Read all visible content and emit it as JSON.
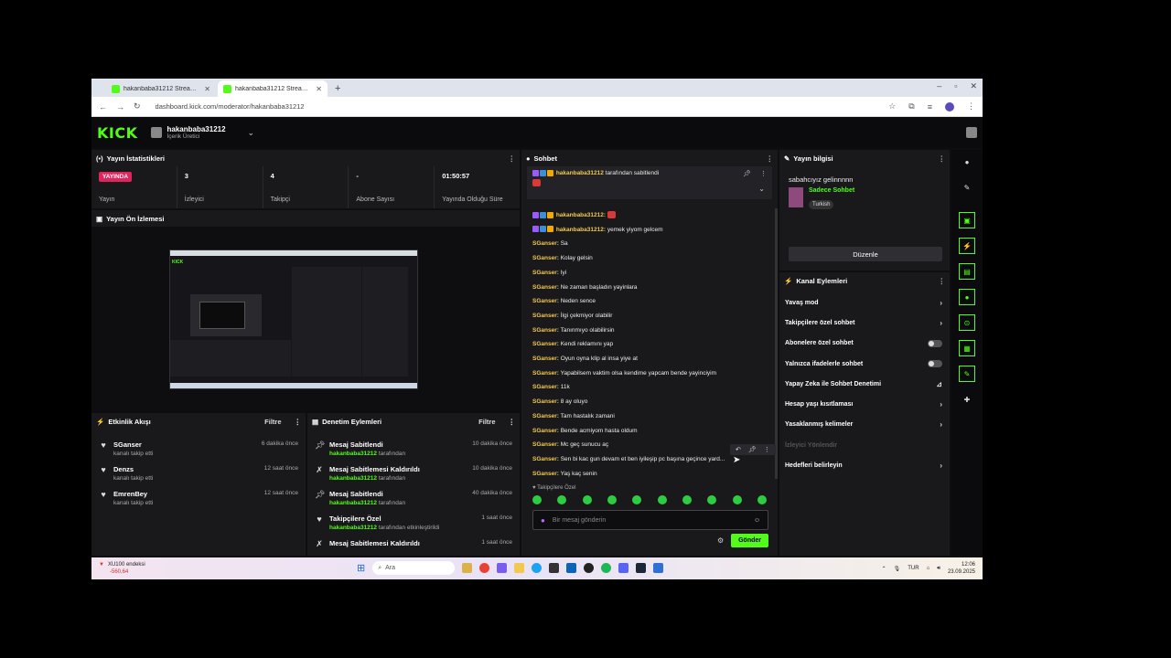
{
  "browser": {
    "tabs": [
      {
        "title": "hakanbaba31212 Stream - Wa...",
        "active": false
      },
      {
        "title": "hakanbaba31212 Stream - Kick",
        "active": true
      }
    ],
    "new_tab": "+",
    "url": "dashboard.kick.com/moderator/hakanbaba31212",
    "window_controls": [
      "–",
      "▫",
      "✕"
    ]
  },
  "header": {
    "logo": "KICK",
    "channel_name": "hakanbaba31212",
    "channel_role": "İçerik Üretici"
  },
  "stats": {
    "title": "Yayın İstatistikleri",
    "items": [
      {
        "value": "YAYINDA",
        "label": "Yayın",
        "badge": true
      },
      {
        "value": "3",
        "label": "İzleyici"
      },
      {
        "value": "4",
        "label": "Takipçi"
      },
      {
        "value": "-",
        "label": "Abone Sayısı"
      },
      {
        "value": "01:50:57",
        "label": "Yayında Olduğu Süre"
      }
    ]
  },
  "preview": {
    "title": "Yayın Ön İzlemesi"
  },
  "activity": {
    "title": "Etkinlik Akışı",
    "filter": "Filtre",
    "items": [
      {
        "name": "SGanser",
        "sub": "kanalı takip etti",
        "time": "6 dakika önce"
      },
      {
        "name": "Denzs",
        "sub": "kanalı takip etti",
        "time": "12 saat önce"
      },
      {
        "name": "EmrenBey",
        "sub": "kanalı takip etti",
        "time": "12 saat önce"
      }
    ]
  },
  "mod_actions": {
    "title": "Denetim Eylemleri",
    "filter": "Filtre",
    "items": [
      {
        "name": "Mesaj Sabitlendi",
        "user": "hakanbaba31212",
        "rest": "tarafından",
        "time": "10 dakika önce",
        "icon": "pin"
      },
      {
        "name": "Mesaj Sabitlemesi Kaldırıldı",
        "user": "hakanbaba31212",
        "rest": "tarafından",
        "time": "10 dakika önce",
        "icon": "unpin"
      },
      {
        "name": "Mesaj Sabitlendi",
        "user": "hakanbaba31212",
        "rest": "tarafından",
        "time": "40 dakika önce",
        "icon": "pin"
      },
      {
        "name": "Takipçilere Özel",
        "user": "hakanbaba31212",
        "rest": "tarafından etkinleştirildi",
        "time": "1 saat önce",
        "icon": "heart"
      },
      {
        "name": "Mesaj Sabitlemesi Kaldırıldı",
        "user": "",
        "rest": "",
        "time": "1 saat önce",
        "icon": "unpin"
      }
    ]
  },
  "chat": {
    "title": "Sohbet",
    "pinned": {
      "user": "hakanbaba31212",
      "text": "tarafından sabitlendi"
    },
    "messages": [
      {
        "user": "hakanbaba31212:",
        "text": "",
        "badges": true,
        "emote": true
      },
      {
        "user": "hakanbaba31212:",
        "text": "yemek yiyom gelcem",
        "badges": true
      },
      {
        "user": "SGanser:",
        "text": "Sa"
      },
      {
        "user": "SGanser:",
        "text": "Kolay gelsin"
      },
      {
        "user": "SGanser:",
        "text": "Iyi"
      },
      {
        "user": "SGanser:",
        "text": "Ne zaman başladın yayinlara"
      },
      {
        "user": "SGanser:",
        "text": "Neden sence"
      },
      {
        "user": "SGanser:",
        "text": "İlgi çekmiyor olabilir"
      },
      {
        "user": "SGanser:",
        "text": "Tanınmıyo olabilirsin"
      },
      {
        "user": "SGanser:",
        "text": "Kendi reklamını yap"
      },
      {
        "user": "SGanser:",
        "text": "Oyun oyna klip al insa yiye at"
      },
      {
        "user": "SGanser:",
        "text": "Yapabilsem vaktim olsa kendime yapcam bende yayinciyim"
      },
      {
        "user": "SGanser:",
        "text": "11k"
      },
      {
        "user": "SGanser:",
        "text": "8 ay oluyo"
      },
      {
        "user": "SGanser:",
        "text": "Tam hastalık zamani"
      },
      {
        "user": "SGanser:",
        "text": "Bende acmiyom hasta oldum"
      },
      {
        "user": "SGanser:",
        "text": "Mc geç sunucu aç"
      },
      {
        "user": "SGanser:",
        "text": "Sen bi kac gun devam et ben iyileşip pc başına geçince yard..."
      },
      {
        "user": "SGanser:",
        "text": "Yaş kaç senin"
      }
    ],
    "follower_only": "♥ Takipçilere Özel",
    "input_placeholder": "Bir mesaj gönderin",
    "send": "Gönder"
  },
  "stream_info": {
    "title": "Yayın bilgisi",
    "stream_title": "sabahcıyız gelinnnnn",
    "category": "Sadece Sohbet",
    "tag": "Turkish",
    "edit": "Düzenle"
  },
  "channel_actions": {
    "title": "Kanal Eylemleri",
    "items": [
      {
        "label": "Yavaş mod",
        "control": "chevron"
      },
      {
        "label": "Takipçilere özel sohbet",
        "control": "chevron"
      },
      {
        "label": "Abonelere özel sohbet",
        "control": "toggle"
      },
      {
        "label": "Yalnızca ifadelerle sohbet",
        "control": "toggle"
      },
      {
        "label": "Yapay Zeka ile Sohbet Denetimi",
        "control": "chart"
      },
      {
        "label": "Hesap yaşı kısıtlaması",
        "control": "chevron"
      },
      {
        "label": "Yasaklanmış kelimeler",
        "control": "chevron"
      },
      {
        "label": "İzleyici Yönlendir",
        "control": "none",
        "dim": true
      },
      {
        "label": "Hedefleri belirleyin",
        "control": "chevron"
      }
    ]
  },
  "taskbar": {
    "weather_title": "XU100 endeksi",
    "weather_value": "-560,64",
    "search_placeholder": "Ara",
    "lang": "TUR",
    "time": "12:06",
    "date": "23.09.2025"
  },
  "colors": {
    "accent": "#53fc18",
    "live": "#e0245e",
    "username": "#f2c94c"
  }
}
